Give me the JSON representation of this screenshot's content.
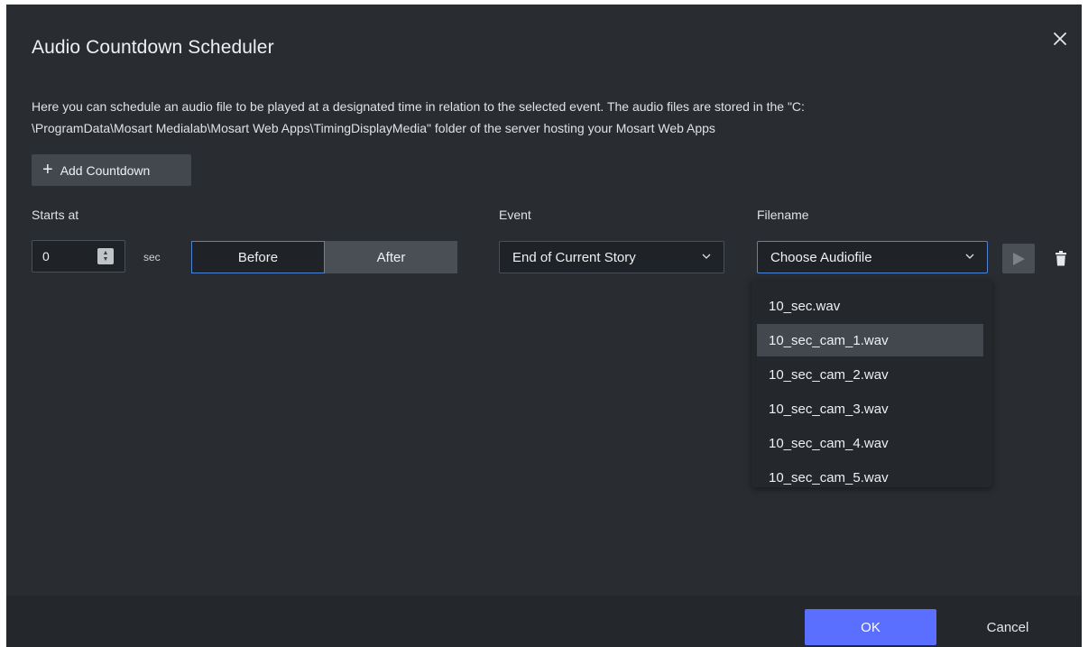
{
  "dialog": {
    "title": "Audio Countdown Scheduler",
    "close_icon": "close-icon",
    "description_line1": "Here you can schedule an audio file to be played at a designated time in relation to the selected event. The audio files are stored in the \"C:",
    "description_line2": "\\ProgramData\\Mosart Medialab\\Mosart Web Apps\\TimingDisplayMedia\" folder of the server hosting your Mosart Web Apps"
  },
  "toolbar": {
    "add_label": "Add Countdown",
    "add_icon": "plus-icon"
  },
  "columns": {
    "starts_at": "Starts at",
    "event": "Event",
    "filename": "Filename"
  },
  "row": {
    "starts_value": "0",
    "unit": "sec",
    "before_label": "Before",
    "after_label": "After",
    "selected_relation": "Before",
    "event_value": "End of Current Story",
    "filename_value": "Choose Audiofile",
    "play_icon": "play-icon",
    "delete_icon": "trash-icon"
  },
  "dropdown": {
    "items": [
      "10_sec.wav",
      "10_sec_cam_1.wav",
      "10_sec_cam_2.wav",
      "10_sec_cam_3.wav",
      "10_sec_cam_4.wav",
      "10_sec_cam_5.wav"
    ],
    "highlighted": "10_sec_cam_1.wav"
  },
  "footer": {
    "ok_label": "OK",
    "cancel_label": "Cancel"
  },
  "colors": {
    "background": "#292d31",
    "footer": "#24272b",
    "accent": "#5a6eff",
    "focus_border": "#4c84d8"
  }
}
